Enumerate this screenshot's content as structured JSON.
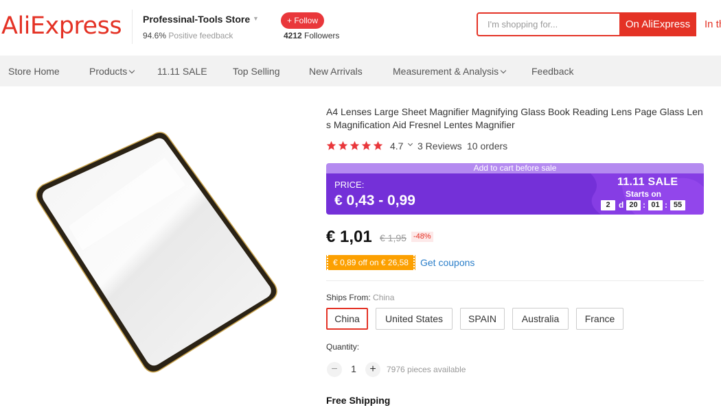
{
  "header": {
    "logo_text": "AliExpress",
    "store_name": "Professinal-Tools Store",
    "feedback_pct": "94.6%",
    "feedback_label": "Positive feedback",
    "follow_label": "+ Follow",
    "followers_count": "4212",
    "followers_label": "Followers",
    "search": {
      "placeholder": "I'm shopping for...",
      "on_aliexpress_label": "On AliExpress",
      "in_store_label": "In th"
    }
  },
  "nav": {
    "items": [
      {
        "label": "Store Home"
      },
      {
        "label": "Products"
      },
      {
        "label": "11.11 SALE"
      },
      {
        "label": "Top Selling"
      },
      {
        "label": "New Arrivals"
      },
      {
        "label": "Measurement & Analysis"
      },
      {
        "label": "Feedback"
      }
    ]
  },
  "product": {
    "title": "A4 Lenses Large Sheet Magnifier Magnifying Glass Book Reading Lens Page Glass Lens Magnification Aid Fresnel Lentes Magnifier",
    "rating": "4.7",
    "stars": 5,
    "reviews": "3 Reviews",
    "orders": "10 orders",
    "sale_banner": {
      "top_text": "Add to cart before sale",
      "price_label": "PRICE:",
      "price_range": "€ 0,43 - 0,99",
      "sale_title": "11.11 SALE",
      "starts_on": "Starts on",
      "countdown": {
        "days": "2",
        "days_unit": "d",
        "hours": "20",
        "minutes": "01",
        "seconds": "55"
      }
    },
    "price_current": "€ 1,01",
    "price_old": "€ 1,95",
    "discount": "-48%",
    "coupon_text": "€ 0,89 off on € 26,58",
    "get_coupons": "Get coupons",
    "ships_from_label": "Ships From:",
    "ships_from_value": "China",
    "ship_options": [
      {
        "label": "China",
        "selected": true
      },
      {
        "label": "United States",
        "selected": false
      },
      {
        "label": "SPAIN",
        "selected": false
      },
      {
        "label": "Australia",
        "selected": false
      },
      {
        "label": "France",
        "selected": false
      }
    ],
    "quantity_label": "Quantity:",
    "quantity_value": "1",
    "qty_minus": "−",
    "qty_plus": "+",
    "available": "7976 pieces available",
    "free_shipping": "Free Shipping"
  },
  "colors": {
    "brand_red": "#e43225",
    "sale_purple": "#7430d8",
    "star_red": "#e9373b",
    "coupon_orange": "#fca001",
    "link_blue": "#2a7ec9"
  }
}
